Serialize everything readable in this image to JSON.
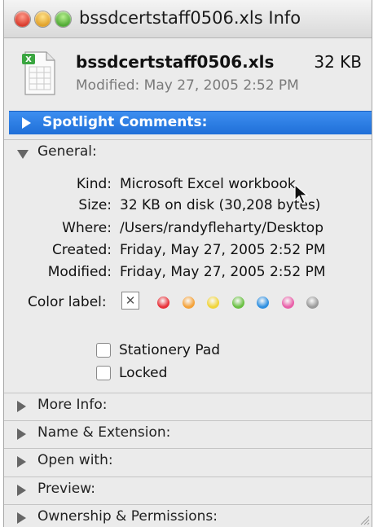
{
  "window": {
    "title": "bssdcertstaff0506.xls Info"
  },
  "file": {
    "name": "bssdcertstaff0506.xls",
    "size": "32 KB",
    "modified": "Modified: May 27, 2005 2:52 PM",
    "icon": "excel-document-icon"
  },
  "sections": {
    "spotlight": "Spotlight Comments:",
    "general": "General:",
    "more_info": "More Info:",
    "name_ext": "Name & Extension:",
    "open_with": "Open with:",
    "preview": "Preview:",
    "ownership": "Ownership & Permissions:"
  },
  "general": {
    "kind_label": "Kind:",
    "kind_value": "Microsoft Excel workbook",
    "size_label": "Size:",
    "size_value": "32 KB on disk (30,208 bytes)",
    "where_label": "Where:",
    "where_value": "/Users/randyfleharty/Desktop",
    "created_label": "Created:",
    "created_value": "Friday, May 27, 2005 2:52 PM",
    "modified_label": "Modified:",
    "modified_value": "Friday, May 27, 2005 2:52 PM",
    "color_label": "Color label:",
    "color_none": "✕",
    "colors": [
      "#e8323a",
      "#f4a23a",
      "#f0d43a",
      "#6ac043",
      "#2f8fe0",
      "#e85fa8",
      "#9a9a9a"
    ],
    "stationery": "Stationery Pad",
    "locked": "Locked"
  },
  "colors": {
    "selection": "#2a7de6"
  }
}
